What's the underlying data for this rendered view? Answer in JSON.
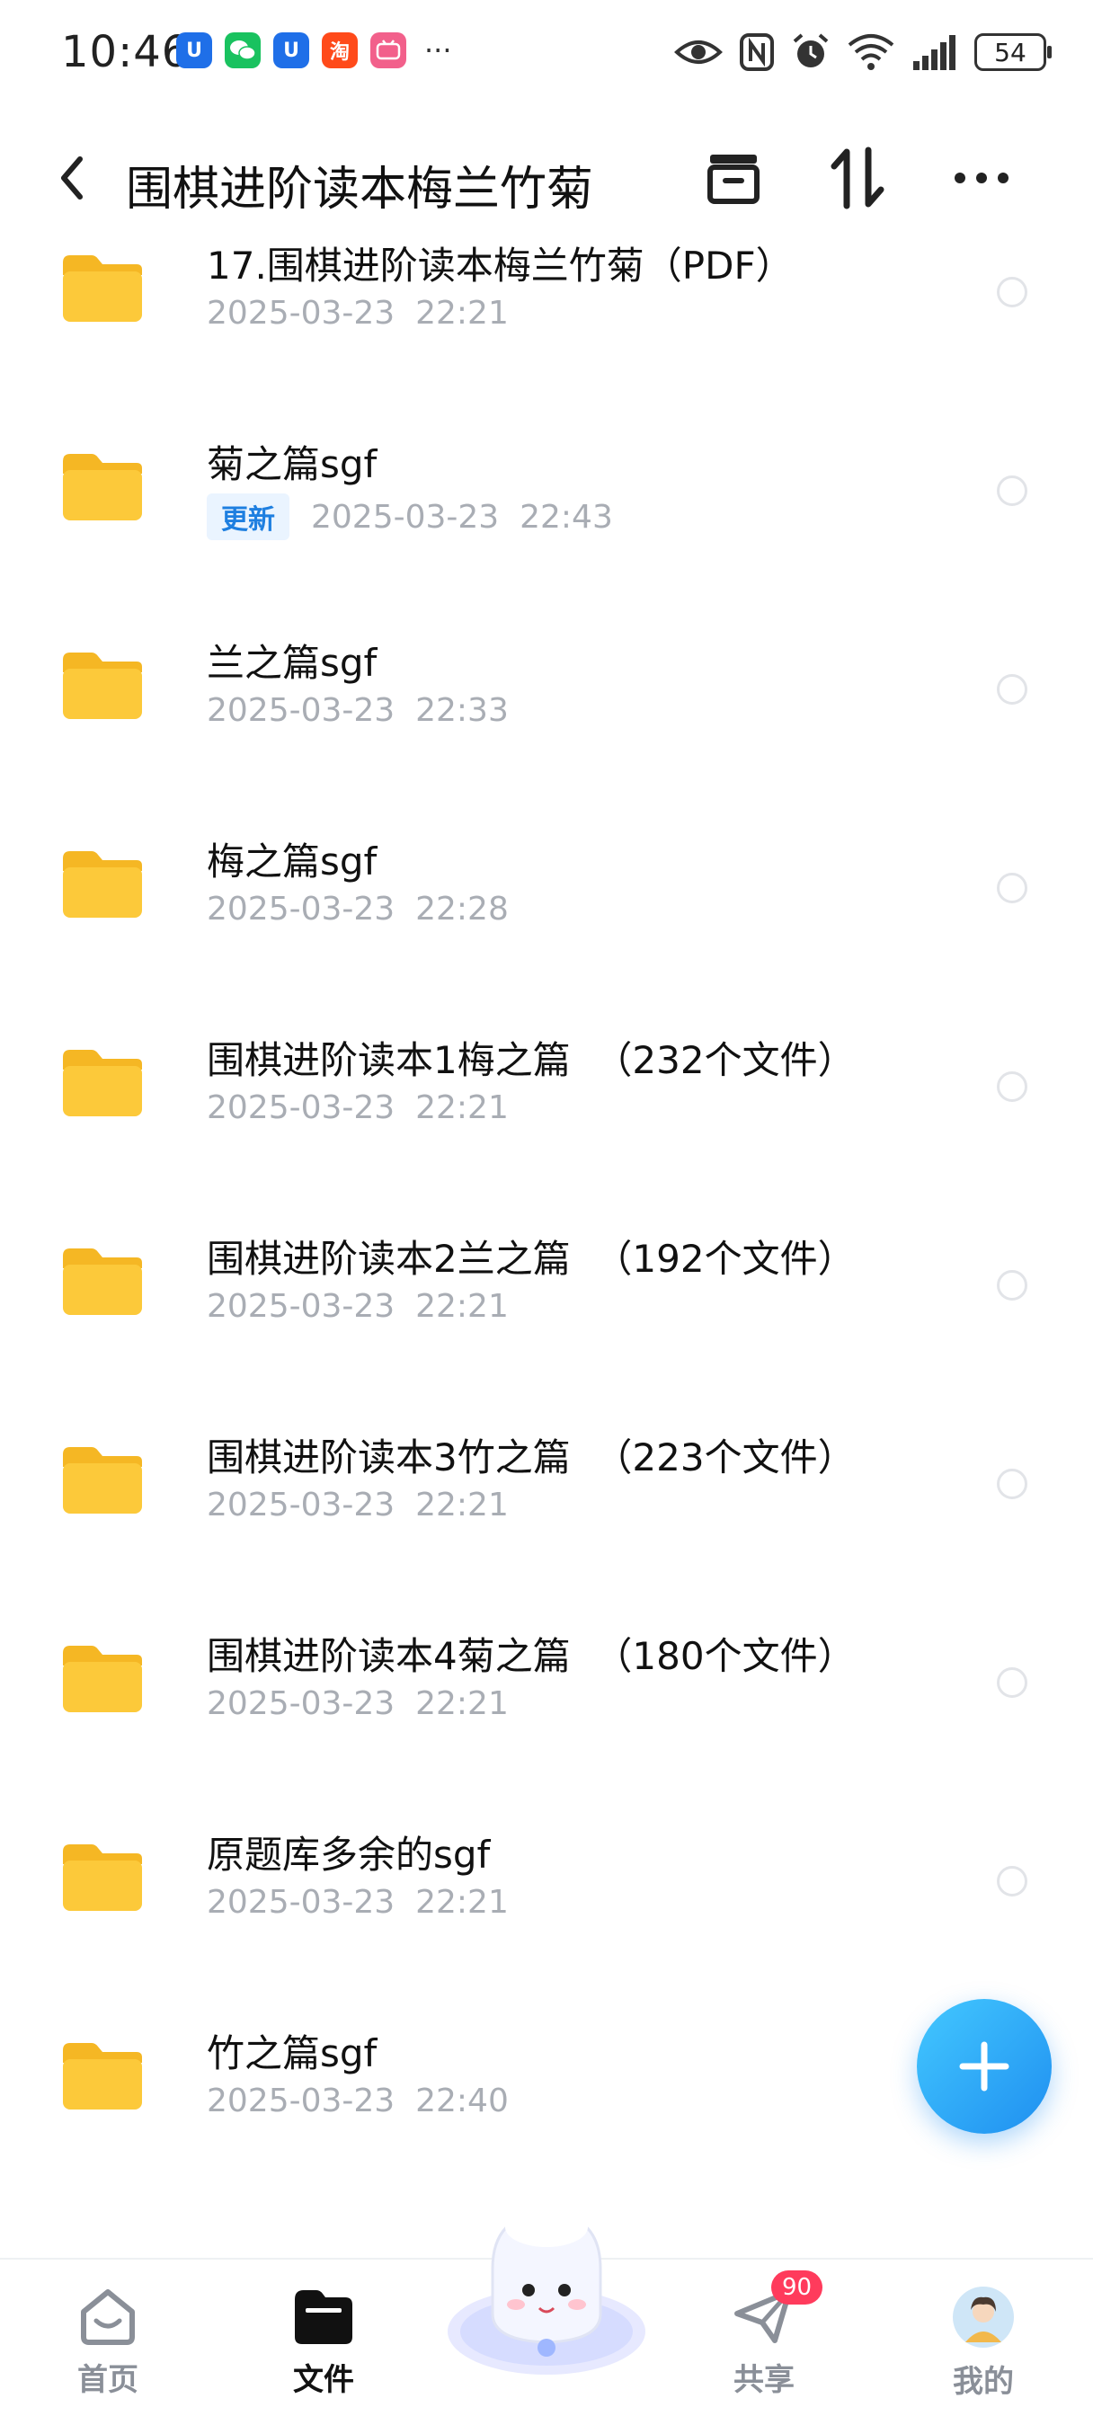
{
  "status_bar": {
    "time": "10:46",
    "app_icons": [
      {
        "icon": "app-u-icon",
        "text": "U",
        "color": "#1f6fe8"
      },
      {
        "icon": "wechat-icon",
        "text": "",
        "color": "#19c25f"
      },
      {
        "icon": "app-u-icon",
        "text": "U",
        "color": "#1f6fe8"
      },
      {
        "icon": "taobao-icon",
        "text": "淘",
        "color": "#ff4a1a"
      },
      {
        "icon": "bilibili-icon",
        "text": "",
        "color": "#f2608b"
      }
    ],
    "more": "···",
    "battery": "54"
  },
  "header": {
    "title": "围棋进阶读本梅兰竹菊"
  },
  "files": [
    {
      "name": "17.围棋进阶读本梅兰竹菊（PDF）",
      "date": "2025-03-23  22:21",
      "tag": ""
    },
    {
      "name": "菊之篇sgf",
      "date": "2025-03-23  22:43",
      "tag": "更新"
    },
    {
      "name": "兰之篇sgf",
      "date": "2025-03-23  22:33",
      "tag": ""
    },
    {
      "name": "梅之篇sgf",
      "date": "2025-03-23  22:28",
      "tag": ""
    },
    {
      "name": "围棋进阶读本1梅之篇  （232个文件）",
      "date": "2025-03-23  22:21",
      "tag": ""
    },
    {
      "name": "围棋进阶读本2兰之篇  （192个文件）",
      "date": "2025-03-23  22:21",
      "tag": ""
    },
    {
      "name": "围棋进阶读本3竹之篇  （223个文件）",
      "date": "2025-03-23  22:21",
      "tag": ""
    },
    {
      "name": "围棋进阶读本4菊之篇  （180个文件）",
      "date": "2025-03-23  22:21",
      "tag": ""
    },
    {
      "name": "原题库多余的sgf",
      "date": "2025-03-23  22:21",
      "tag": ""
    },
    {
      "name": "竹之篇sgf",
      "date": "2025-03-23  22:40",
      "tag": ""
    }
  ],
  "nav": {
    "home": "首页",
    "files": "文件",
    "share": "共享",
    "share_badge": "90",
    "mine": "我的"
  },
  "colors": {
    "accent": "#1e7fe0",
    "folder": "#fcc93a",
    "badge": "#ff3b5c"
  }
}
